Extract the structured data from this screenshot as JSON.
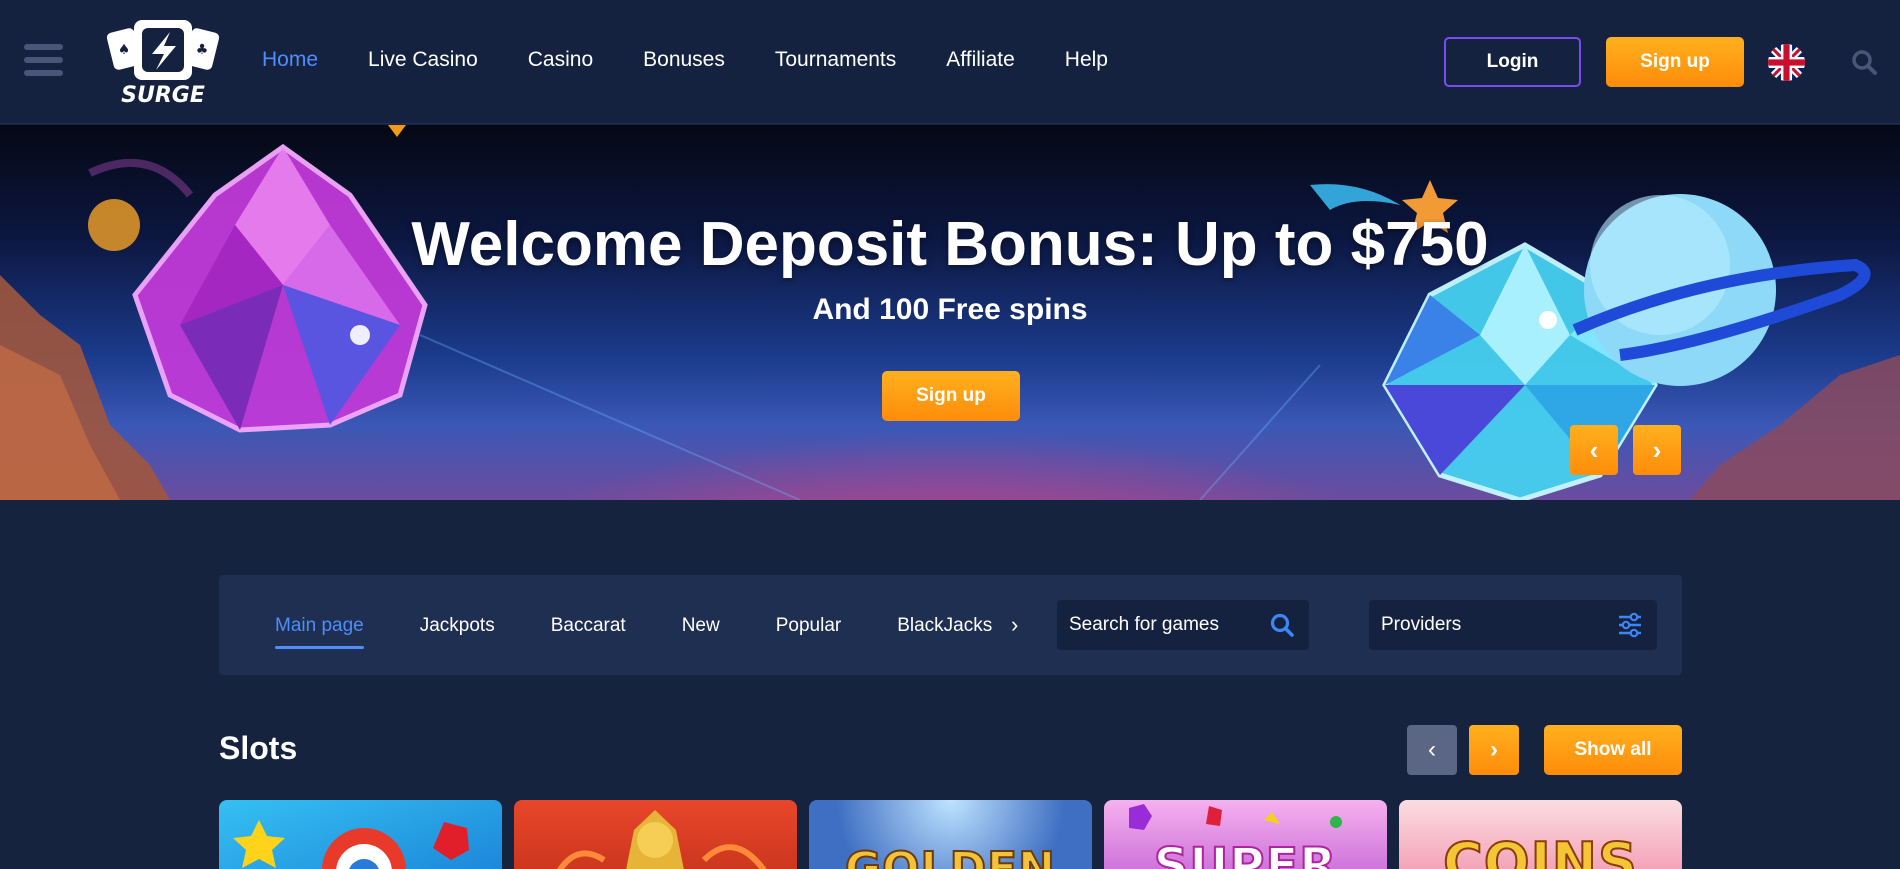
{
  "header": {
    "logo_text": "SURGE",
    "nav": [
      {
        "label": "Home",
        "active": true
      },
      {
        "label": "Live Casino"
      },
      {
        "label": "Casino"
      },
      {
        "label": "Bonuses"
      },
      {
        "label": "Tournaments"
      },
      {
        "label": "Affiliate"
      },
      {
        "label": "Help"
      }
    ],
    "login_label": "Login",
    "signup_label": "Sign up",
    "language_icon": "uk-flag-icon",
    "search_icon": "search-icon"
  },
  "hero": {
    "title": "Welcome Deposit Bonus: Up to $750",
    "subtitle": "And 100 Free spins",
    "cta_label": "Sign up",
    "prev_icon": "‹",
    "next_icon": "›"
  },
  "filters": {
    "categories": [
      {
        "label": "Main page",
        "active": true
      },
      {
        "label": "Jackpots"
      },
      {
        "label": "Baccarat"
      },
      {
        "label": "New"
      },
      {
        "label": "Popular"
      },
      {
        "label": "BlackJacks"
      }
    ],
    "more_icon": "›",
    "search_placeholder": "Search for games",
    "providers_label": "Providers"
  },
  "slots": {
    "title": "Slots",
    "prev_icon": "‹",
    "next_icon": "›",
    "show_all_label": "Show all",
    "games": [
      {
        "label": "",
        "bg": "#23a9e8"
      },
      {
        "label": "",
        "bg": "#d2481c"
      },
      {
        "label": "GOLDEN",
        "bg": "#4d7fd0"
      },
      {
        "label": "SUPER",
        "bg": "#e07ad8"
      },
      {
        "label": "COINS",
        "bg": "#f2b9c4"
      }
    ]
  },
  "colors": {
    "accent_blue": "#4f8dfa",
    "orange": "#ff9a12",
    "header_bg": "#15223f",
    "page_bg": "#16233f",
    "panel_bg": "#1f2f52"
  }
}
